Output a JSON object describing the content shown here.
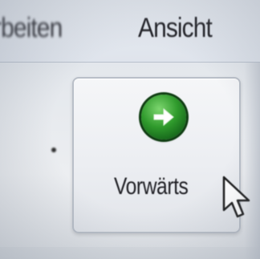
{
  "menubar": {
    "items": [
      {
        "label": "rbeiten"
      },
      {
        "label": "Ansicht"
      }
    ]
  },
  "toolbar": {
    "forward_button": {
      "label": "Vorwärts",
      "icon": "arrow-right-icon"
    },
    "next_fragment": "..."
  },
  "colors": {
    "forward_icon_green": "#2f9a2c",
    "background": "#e6e9ee"
  }
}
